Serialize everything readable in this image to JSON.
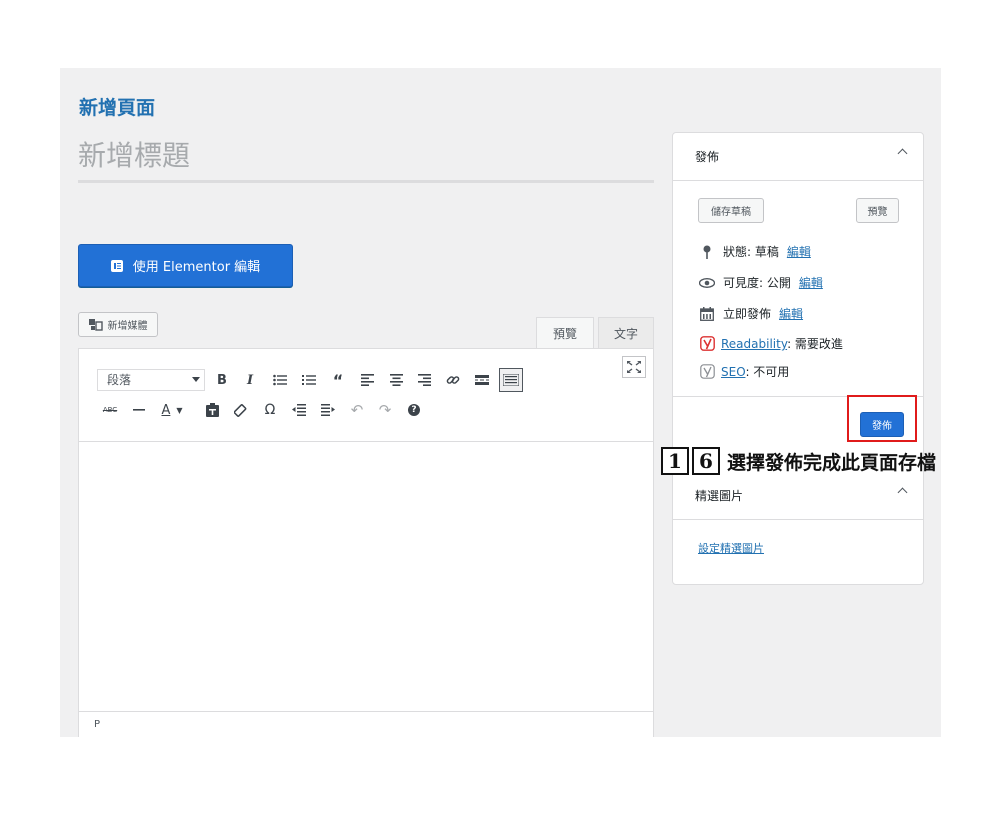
{
  "page": {
    "heading": "新增頁面",
    "title_placeholder": "新增標題"
  },
  "elementor": {
    "label": "使用 Elementor 編輯",
    "icon": "elementor-icon"
  },
  "media": {
    "label": "新增媒體",
    "icon": "add-media-icon"
  },
  "editor_tabs": {
    "visual": "預覽",
    "text": "文字"
  },
  "toolbar": {
    "format_value": "段落",
    "row1": [
      "bold-icon",
      "italic-icon",
      "bullet-list-icon",
      "numbered-list-icon",
      "blockquote-icon",
      "align-left-icon",
      "align-center-icon",
      "align-right-icon",
      "link-icon",
      "read-more-icon",
      "toolbar-toggle-icon"
    ],
    "row2": [
      "strikethrough-icon",
      "horizontal-line-icon",
      "text-color-icon",
      "paste-text-icon",
      "clear-formatting-icon",
      "special-character-icon",
      "outdent-icon",
      "indent-icon",
      "undo-icon",
      "redo-icon",
      "help-icon"
    ]
  },
  "status_bar": {
    "path": "P"
  },
  "publish_box": {
    "title": "發佈",
    "save_draft": "儲存草稿",
    "preview": "預覽",
    "status": {
      "label": "狀態: 草稿",
      "link": "編輯"
    },
    "visibility": {
      "label": "可見度: 公開",
      "link": "編輯"
    },
    "schedule": {
      "label": "立即發佈",
      "link": "編輯"
    },
    "readability": {
      "link": "Readability",
      "value": ": 需要改進"
    },
    "seo": {
      "link": "SEO",
      "value": ": 不可用"
    },
    "publish": "發佈"
  },
  "annotation": {
    "n1": "1",
    "n2": "6",
    "text": "選擇發佈完成此頁面存檔"
  },
  "featured_image": {
    "title": "精選圖片",
    "link": "設定精選圖片"
  },
  "colors": {
    "accent": "#2271d6",
    "link": "#2271b1",
    "highlight": "#e01b1b",
    "yoast_red": "#dc3232"
  }
}
